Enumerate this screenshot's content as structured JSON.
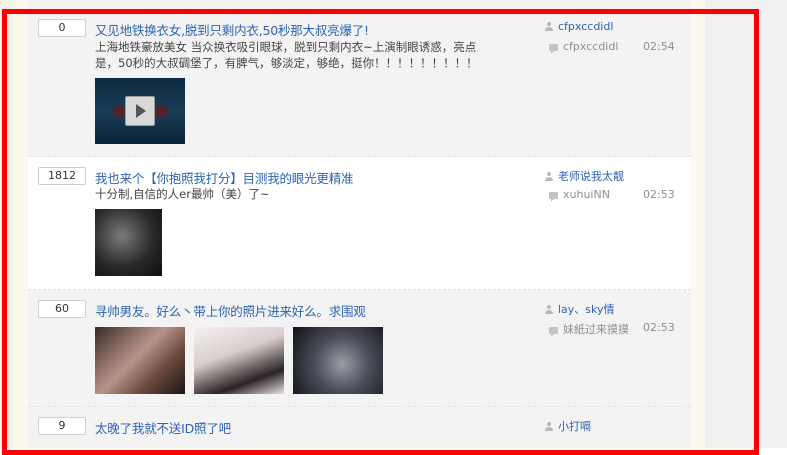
{
  "threads": [
    {
      "replies": "0",
      "title": "又见地铁换衣女,脱到只剩内衣,50秒那大叔亮爆了!",
      "description": "上海地铁豪放美女 当众换衣吸引眼球，脱到只剩内衣~上演制眼诱惑，亮点是，50秒的大叔碉堡了，有脾气，够淡定，够绝，挺你！！！！！！！！！",
      "author": "cfpxccdidl",
      "last_reply_by": "cfpxccdidl",
      "time": "02:54"
    },
    {
      "replies": "1812",
      "title": "我也来个【你抱照我打分】目测我的眼光更精准",
      "description": "十分制,自信的人er最帅（美）了~",
      "author": "老师说我太靓",
      "last_reply_by": "xuhuiNN",
      "time": "02:53"
    },
    {
      "replies": "60",
      "title": "寻帅男友。好么丶带上你的照片进来好么。求围观",
      "author": "lay、sky情",
      "last_reply_by": "妹紙过来摸摸",
      "time": "02:53"
    },
    {
      "replies": "9",
      "title": "太晚了我就不送ID照了吧",
      "author": "小打嗝"
    }
  ],
  "colors": {
    "frame": "#ff0000",
    "link": "#2d64b3"
  }
}
